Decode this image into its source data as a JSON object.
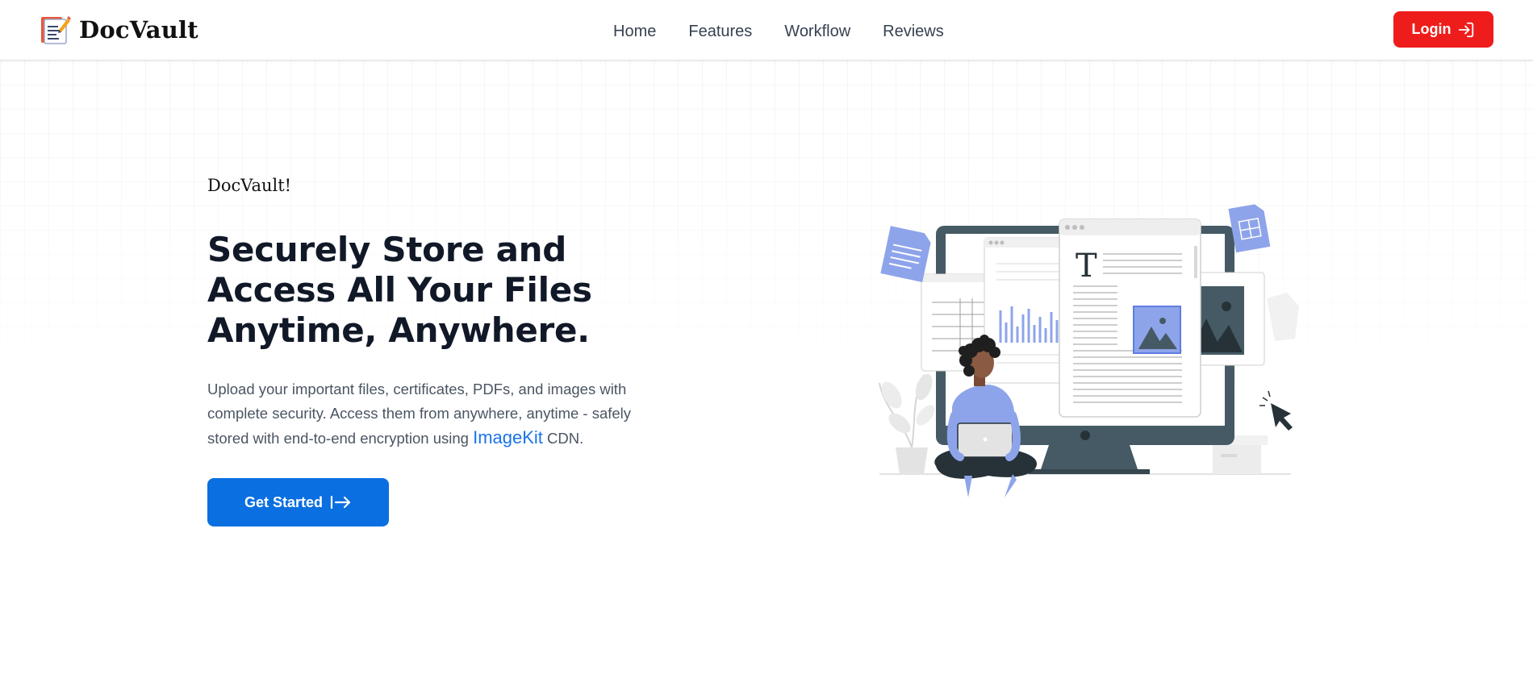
{
  "header": {
    "brand_name": "DocVault",
    "nav": [
      "Home",
      "Features",
      "Workflow",
      "Reviews"
    ],
    "login_label": "Login"
  },
  "hero": {
    "eyebrow": "DocVault!",
    "headline": "Securely Store and Access All Your Files Anytime, Anywhere.",
    "description_before_link": "Upload your important files, certificates, PDFs, and images with complete security. Access them from anywhere, anytime - safely stored with end-to-end encryption using ",
    "description_link": "ImageKit",
    "description_after_link": " CDN.",
    "cta_label": "Get Started"
  },
  "colors": {
    "login_button": "#ef1c1c",
    "cta_button": "#0a6fe0",
    "link": "#1a73e8",
    "accent_illustration": "#8ea4ea",
    "monitor": "#455a64"
  },
  "icons": {
    "brand": "document-pen-logo-icon",
    "login": "login-arrow-icon",
    "cta": "arrow-right-bar-icon"
  }
}
